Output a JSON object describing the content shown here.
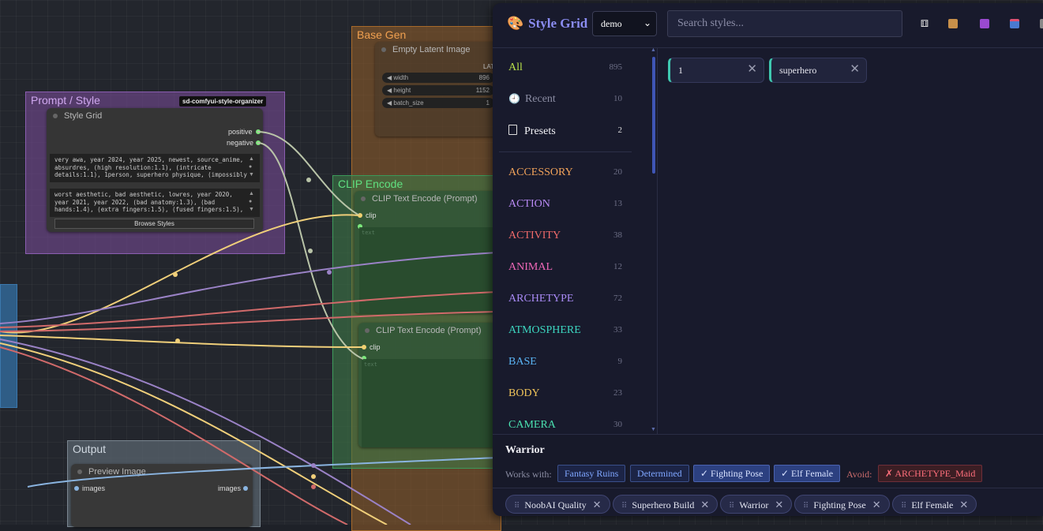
{
  "canvas": {
    "groups": {
      "base_gen": "Base Gen",
      "prompt_style": "Prompt / Style",
      "clip_encode": "CLIP Encode",
      "output": "Output"
    },
    "badge": "sd-comfyui-style-organizer",
    "empty_latent": {
      "title": "Empty Latent Image",
      "out_label": "LAT",
      "width_label": "width",
      "width_value": "896",
      "height_label": "height",
      "height_value": "1152",
      "batch_label": "batch_size",
      "batch_value": "1"
    },
    "style_grid_node": {
      "title": "Style Grid",
      "positive": "positive",
      "negative": "negative",
      "positive_text": "very awa, year 2024, year 2025, newest, source_anime,\nabsurdres, (high resolution:1.1), (intricate\ndetails:1.1), 1person, superhero physique, (impossibly",
      "negative_text": "worst aesthetic, bad aesthetic, lowres, year 2020,\nyear 2021, year 2022, (bad anatomy:1.3), (bad\nhands:1.4), (extra fingers:1.5), (fused fingers:1.5),",
      "browse_button": "Browse Styles"
    },
    "clip1": {
      "title": "CLIP Text Encode (Prompt)",
      "input": "clip",
      "text_placeholder": "text"
    },
    "clip2": {
      "title": "CLIP Text Encode (Prompt)",
      "input": "clip",
      "text_placeholder": "text"
    },
    "preview": {
      "title": "Preview Image",
      "input": "images",
      "output": "images"
    }
  },
  "panel": {
    "title": "Style Grid",
    "preset_select": "demo",
    "search_placeholder": "Search styles...",
    "toolbar_icons": [
      "dice-icon",
      "package-icon",
      "save-icon",
      "inbox-icon",
      "more-icon"
    ],
    "sidebar_top": [
      {
        "label": "All",
        "count": "895",
        "color": "#b8e04a"
      },
      {
        "label": "Recent",
        "count": "10",
        "color": "#8a8ca2",
        "icon": "clock-icon"
      },
      {
        "label": "Presets",
        "count": "2",
        "color": "#f2f2f6",
        "icon": "bookmark-icon"
      }
    ],
    "categories": [
      {
        "label": "ACCESSORY",
        "count": "20",
        "color": "#f0a25a"
      },
      {
        "label": "ACTION",
        "count": "13",
        "color": "#b98af5"
      },
      {
        "label": "ACTIVITY",
        "count": "38",
        "color": "#f06a6a"
      },
      {
        "label": "ANIMAL",
        "count": "12",
        "color": "#f068b8"
      },
      {
        "label": "ARCHETYPE",
        "count": "72",
        "color": "#a88af5"
      },
      {
        "label": "ATMOSPHERE",
        "count": "33",
        "color": "#3cd6c0"
      },
      {
        "label": "BASE",
        "count": "9",
        "color": "#5ab4f5"
      },
      {
        "label": "BODY",
        "count": "23",
        "color": "#f0c45a"
      },
      {
        "label": "CAMERA",
        "count": "30",
        "color": "#4ae0b0"
      }
    ],
    "search_tags": [
      {
        "label": "1"
      },
      {
        "label": "superhero"
      }
    ],
    "detail": {
      "title": "Warrior",
      "works_with_label": "Works with:",
      "works_with": [
        {
          "label": "Fantasy Ruins",
          "active": false
        },
        {
          "label": "Determined",
          "active": false
        },
        {
          "label": "✓ Fighting Pose",
          "active": true
        },
        {
          "label": "✓ Elf Female",
          "active": true
        }
      ],
      "avoid_label": "Avoid:",
      "avoid": [
        {
          "label": "✗ ARCHETYPE_Maid"
        }
      ]
    },
    "selected": [
      {
        "label": "NoobAI Quality"
      },
      {
        "label": "Superhero Build"
      },
      {
        "label": "Warrior"
      },
      {
        "label": "Fighting Pose"
      },
      {
        "label": "Elf Female"
      }
    ]
  }
}
